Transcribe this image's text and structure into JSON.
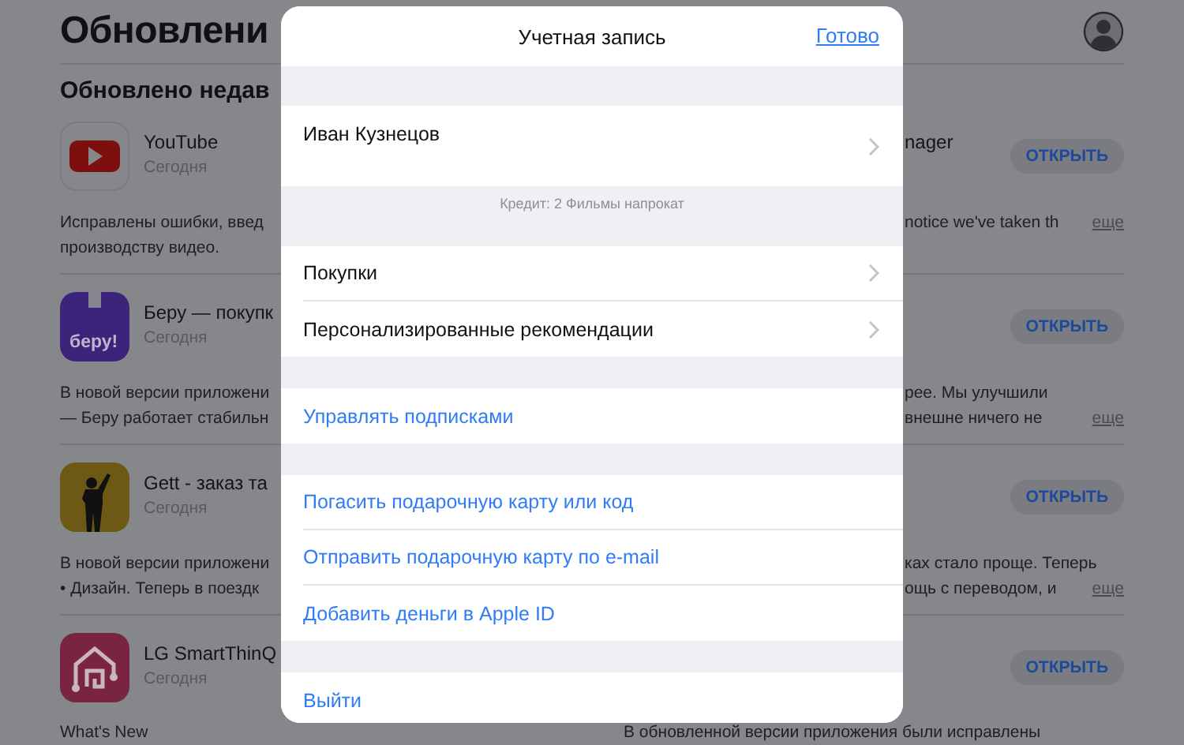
{
  "page": {
    "title": "Обновлени",
    "section": "Обновлено недав"
  },
  "rows": [
    {
      "left": {
        "name": "YouTube",
        "date": "Сегодня",
        "description": [
          "Исправлены ошибки, введ",
          "производству видео."
        ]
      },
      "right": {
        "name": "nager",
        "button": "ОТКРЫТЬ",
        "description": [
          "notice we've taken th"
        ],
        "more": "еще"
      }
    },
    {
      "left": {
        "icon_text": "беру!",
        "name": "Беру — покупк",
        "date": "Сегодня",
        "description": [
          "В новой версии приложени",
          "— Беру работает стабильн"
        ]
      },
      "right": {
        "button": "ОТКРЫТЬ",
        "description": [
          "рее. Мы улучшили",
          "внешне ничего не"
        ],
        "more": "еще"
      }
    },
    {
      "left": {
        "name": "Gett - заказ та",
        "date": "Сегодня",
        "description": [
          "В новой версии приложени",
          "• Дизайн. Теперь в поездк"
        ]
      },
      "right": {
        "button": "ОТКРЫТЬ",
        "description": [
          "ках стало проще. Теперь",
          "ощь с переводом, и"
        ],
        "more": "еще"
      }
    },
    {
      "left": {
        "name": "LG SmartThinQ",
        "date": "Сегодня",
        "description": [
          "What's New"
        ]
      },
      "right": {
        "button": "ОТКРЫТЬ",
        "description": [
          "В обновленной версии приложения были исправлены"
        ],
        "full": true
      }
    }
  ],
  "modal": {
    "title": "Учетная запись",
    "done": "Готово",
    "sections": [
      {
        "rows": [
          {
            "kind": "account",
            "label": "Иван Кузнецов"
          }
        ],
        "footer": "Кредит: 2 Фильмы напрокат"
      },
      {
        "rows": [
          {
            "kind": "nav",
            "label": "Покупки"
          },
          {
            "kind": "nav",
            "label": "Персонализированные рекомендации"
          }
        ]
      },
      {
        "rows": [
          {
            "kind": "action",
            "label": "Управлять подписками"
          }
        ]
      },
      {
        "rows": [
          {
            "kind": "action",
            "label": "Погасить подарочную карту или код"
          },
          {
            "kind": "action",
            "label": "Отправить подарочную карту по e-mail"
          },
          {
            "kind": "action",
            "label": "Добавить деньги в Apple ID"
          }
        ]
      },
      {
        "rows": [
          {
            "kind": "action",
            "label": "Выйти"
          }
        ]
      }
    ]
  }
}
